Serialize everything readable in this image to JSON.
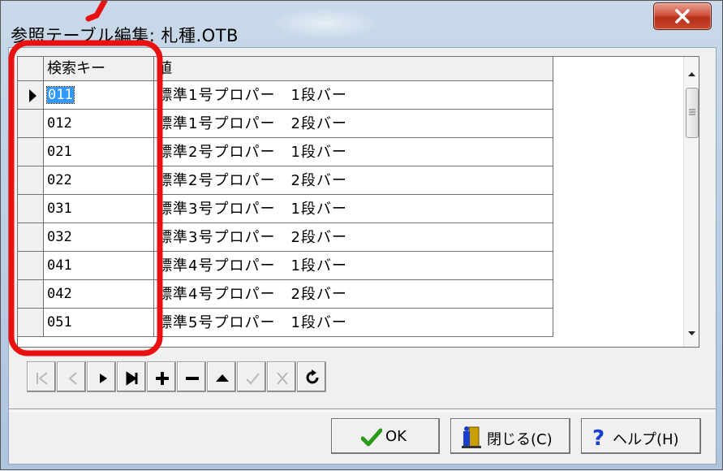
{
  "window": {
    "title": "参照テーブル編集: 札種.OTB"
  },
  "grid": {
    "columns": [
      "検索キー",
      "値"
    ],
    "rows": [
      {
        "key": "011",
        "value": "標準1号プロパー　1段バー",
        "current": true
      },
      {
        "key": "012",
        "value": "標準1号プロパー　2段バー"
      },
      {
        "key": "021",
        "value": "標準2号プロパー　1段バー"
      },
      {
        "key": "022",
        "value": "標準2号プロパー　2段バー"
      },
      {
        "key": "031",
        "value": "標準3号プロパー　1段バー"
      },
      {
        "key": "032",
        "value": "標準3号プロパー　2段バー"
      },
      {
        "key": "041",
        "value": "標準4号プロパー　1段バー"
      },
      {
        "key": "042",
        "value": "標準4号プロパー　2段バー"
      },
      {
        "key": "051",
        "value": "標準5号プロパー　1段バー"
      }
    ]
  },
  "navigator": {
    "buttons": [
      {
        "name": "first-record",
        "icon": "first-icon",
        "enabled": false
      },
      {
        "name": "prior-record",
        "icon": "prior-icon",
        "enabled": false
      },
      {
        "name": "next-record",
        "icon": "next-icon",
        "enabled": true
      },
      {
        "name": "last-record",
        "icon": "last-icon",
        "enabled": true
      },
      {
        "name": "insert-record",
        "icon": "plus-icon",
        "enabled": true
      },
      {
        "name": "delete-record",
        "icon": "minus-icon",
        "enabled": true
      },
      {
        "name": "edit-record",
        "icon": "up-triangle-icon",
        "enabled": true
      },
      {
        "name": "post-record",
        "icon": "check-icon",
        "enabled": false
      },
      {
        "name": "cancel-record",
        "icon": "x-icon",
        "enabled": false
      },
      {
        "name": "refresh-record",
        "icon": "refresh-icon",
        "enabled": true
      }
    ]
  },
  "buttons": {
    "ok": "OK",
    "close": "閉じる(C)",
    "help": "ヘルプ(H)"
  },
  "colors": {
    "annotation": "#e81010",
    "selection": "#3399ff",
    "ok_check": "#2a9a1a",
    "help_icon": "#1a3fd0"
  }
}
